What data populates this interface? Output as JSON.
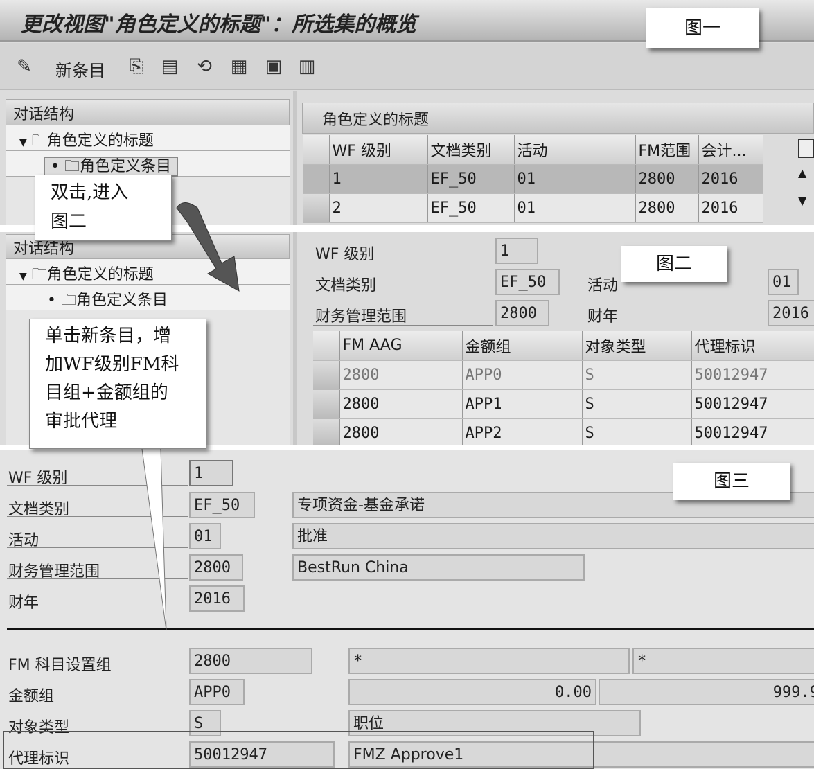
{
  "fig1": {
    "title": "更改视图\"角色定义的标题\"：所选集的概览",
    "toolbar": {
      "new_entry": "新条目",
      "icons": [
        "edit-pencil-icon",
        "copy-icon",
        "delete-icon",
        "undo-icon",
        "select-all-icon",
        "select-block-icon",
        "deselect-all-icon"
      ]
    },
    "dialog_structure": "对话结构",
    "tree": [
      "角色定义的标题",
      "角色定义条目"
    ],
    "table_title": "角色定义的标题",
    "columns": [
      "WF 级别",
      "文档类别",
      "活动",
      "FM范围",
      "会计..."
    ],
    "rows": [
      [
        "1",
        "EF_50",
        "01",
        "2800",
        "2016"
      ],
      [
        "2",
        "EF_50",
        "01",
        "2800",
        "2016"
      ]
    ],
    "label": "图一"
  },
  "callout1": [
    "双击,进入",
    "图二"
  ],
  "fig2": {
    "dialog_structure": "对话结构",
    "tree": [
      "角色定义的标题",
      "角色定义条目"
    ],
    "fields": {
      "wf_level_label": "WF 级别",
      "wf_level": "1",
      "doc_type_label": "文档类别",
      "doc_type": "EF_50",
      "fm_area_label": "财务管理范围",
      "fm_area": "2800",
      "activity_label": "活动",
      "activity": "01",
      "fiscal_year_label": "财年",
      "fiscal_year": "2016"
    },
    "columns": [
      "FM AAG",
      "金额组",
      "对象类型",
      "代理标识"
    ],
    "rows": [
      [
        "2800",
        "APP0",
        "S",
        "50012947"
      ],
      [
        "2800",
        "APP1",
        "S",
        "50012947"
      ],
      [
        "2800",
        "APP2",
        "S",
        "50012947"
      ]
    ],
    "label": "图二"
  },
  "callout2": [
    "单击新条目，增",
    "加WF级别FM科",
    "目组+金额组的",
    "审批代理"
  ],
  "fig3": {
    "label": "图三",
    "wf_level_label": "WF 级别",
    "wf_level": "1",
    "doc_type_label": "文档类别",
    "doc_type": "EF_50",
    "doc_type_text": "专项资金-基金承诺",
    "activity_label": "活动",
    "activity": "01",
    "activity_text": "批准",
    "fm_area_label": "财务管理范围",
    "fm_area": "2800",
    "fm_area_text": "BestRun China",
    "fiscal_year_label": "财年",
    "fiscal_year": "2016",
    "fm_aag_label": "FM 科目设置组",
    "fm_aag": "2800",
    "fm_aag_from": "*",
    "fm_aag_to": "*",
    "amount_group_label": "金额组",
    "amount_group": "APP0",
    "amount_from": "0.00",
    "amount_to": "999.9",
    "object_type_label": "对象类型",
    "object_type": "S",
    "object_type_text": "职位",
    "agent_label": "代理标识",
    "agent": "50012947",
    "agent_text": "FMZ Approve1"
  }
}
